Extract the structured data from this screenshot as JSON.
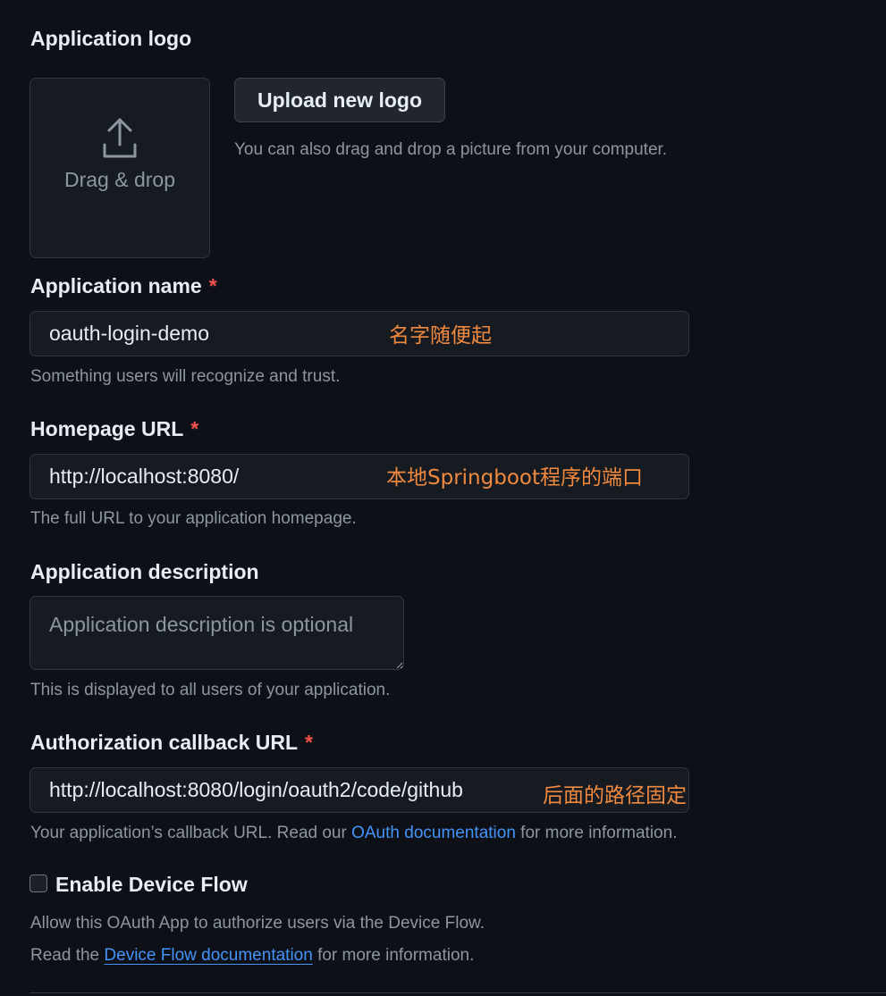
{
  "logo": {
    "label": "Application logo",
    "drop_text": "Drag & drop",
    "upload_label": "Upload new logo",
    "hint": "You can also drag and drop a picture from your computer.",
    "icon": "upload-icon"
  },
  "app_name": {
    "label": "Application name",
    "required": "*",
    "value": "oauth-login-demo",
    "hint": "Something users will recognize and trust.",
    "note": "名字随便起"
  },
  "homepage": {
    "label": "Homepage URL",
    "required": "*",
    "value": "http://localhost:8080/",
    "hint": "The full URL to your application homepage.",
    "note": "本地Springboot程序的端口"
  },
  "description": {
    "label": "Application description",
    "placeholder": "Application description is optional",
    "hint": "This is displayed to all users of your application."
  },
  "callback": {
    "label": "Authorization callback URL",
    "required": "*",
    "value": "http://localhost:8080/login/oauth2/code/github",
    "hint_prefix": "Your application’s callback URL. Read our ",
    "hint_link": "OAuth documentation",
    "hint_suffix": " for more information.",
    "note": "后面的路径固定"
  },
  "device_flow": {
    "label": "Enable Device Flow",
    "hint": "Allow this OAuth App to authorize users via the Device Flow.",
    "read_prefix": "Read the ",
    "read_link": "Device Flow documentation",
    "read_suffix": " for more information."
  },
  "colors": {
    "background": "#0d1117",
    "accent_link": "#4493f8",
    "required": "#f85149",
    "annotation": "#f0883e"
  }
}
